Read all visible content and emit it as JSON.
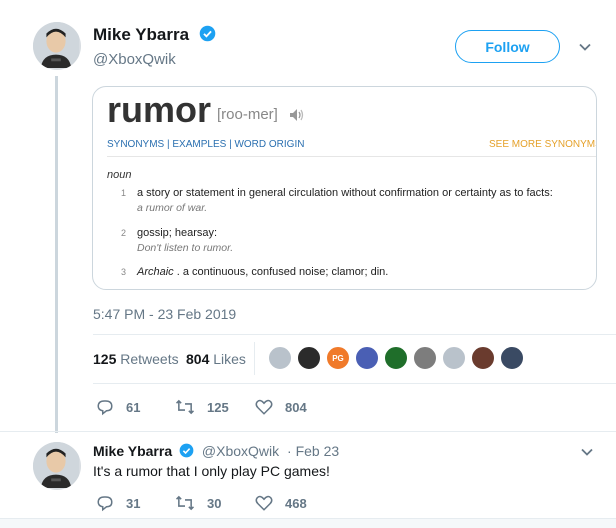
{
  "tweet": {
    "author_name": "Mike Ybarra",
    "author_handle": "@XboxQwik",
    "follow_label": "Follow",
    "timestamp": "5:47 PM - 23 Feb 2019",
    "retweets_count": "125",
    "retweets_label": "Retweets",
    "likes_count": "804",
    "likes_label": "Likes",
    "actions": {
      "replies": "61",
      "retweets": "125",
      "likes": "804"
    }
  },
  "card": {
    "word": "rumor",
    "pronunciation": "[roo-mer]",
    "links": "SYNONYMS | EXAMPLES | WORD ORIGIN",
    "more_synonyms": "SEE MORE SYNONYMS F",
    "part_of_speech": "noun",
    "definitions": [
      {
        "num": "1",
        "text": "a story or statement in general circulation without confirmation or certainty as to facts:",
        "example": "a rumor of war."
      },
      {
        "num": "2",
        "text": "gossip; hearsay:",
        "example": "Don't listen to rumor."
      },
      {
        "num": "3",
        "label": "Archaic",
        "text": ". a continuous, confused noise; clamor; din."
      }
    ]
  },
  "likers": [
    {
      "color": "#b9c2cb",
      "icon": "default-avatar-icon"
    },
    {
      "color": "#2b2b2b",
      "icon": "avatar-icon"
    },
    {
      "color": "#f07a2a",
      "label": "PG",
      "icon": "avatar-icon"
    },
    {
      "color": "#4a5fb4",
      "icon": "avatar-icon"
    },
    {
      "color": "#1f6e2a",
      "icon": "avatar-icon"
    },
    {
      "color": "#7d7d7d",
      "icon": "avatar-icon"
    },
    {
      "color": "#b9c2cb",
      "icon": "default-avatar-icon"
    },
    {
      "color": "#6a3b2e",
      "icon": "avatar-icon"
    },
    {
      "color": "#3a4a63",
      "icon": "avatar-icon"
    }
  ],
  "reply": {
    "author_name": "Mike Ybarra",
    "author_handle": "@XboxQwik",
    "date": "· Feb 23",
    "text": "It's a rumor that I only play PC games!",
    "actions": {
      "replies": "31",
      "retweets": "30",
      "likes": "468"
    }
  },
  "colors": {
    "accent": "#1da1f2",
    "muted": "#657786",
    "link": "#2a6fb0",
    "orange": "#e5a12a"
  }
}
